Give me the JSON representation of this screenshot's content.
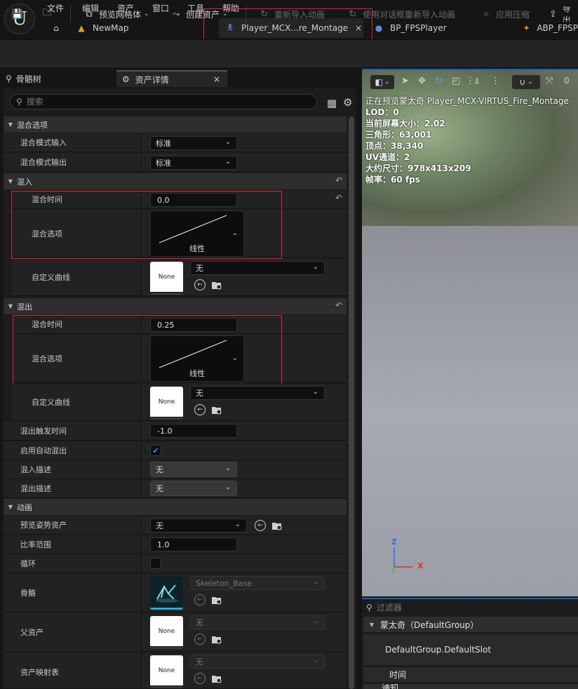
{
  "menu": [
    "文件",
    "编辑",
    "资产",
    "窗口",
    "工具",
    "帮助"
  ],
  "tabs": [
    {
      "label": "NewMap"
    },
    {
      "label": "Player_MCX...re_Montage"
    },
    {
      "label": "BP_FPSPlayer"
    },
    {
      "label": "ABP_FPSP"
    }
  ],
  "toolbar": {
    "preview_mesh": "预览网格体",
    "create_asset": "创建资产",
    "reimport": "重新导入动画",
    "reimport_dialog": "使用对话框重新导入动画",
    "apply_compression": "应用压缩",
    "export": "导出"
  },
  "panels": {
    "skeleton_tree": "骨骼树",
    "asset_details": "资产详情"
  },
  "search": {
    "placeholder": "搜索"
  },
  "blend_options": {
    "category": "混合选项",
    "blend_mode_in_label": "混合模式输入",
    "blend_mode_in_value": "标准",
    "blend_mode_out_label": "混合模式输出",
    "blend_mode_out_value": "标准"
  },
  "blend_in": {
    "category": "混入",
    "time_label": "混合时间",
    "time_value": "0.0",
    "option_label": "混合选项",
    "option_value": "线性",
    "custom_curve_label": "自定义曲线",
    "custom_curve_value": "无",
    "curve_thumb": "None"
  },
  "blend_out": {
    "category": "混出",
    "time_label": "混合时间",
    "time_value": "0.25",
    "option_label": "混合选项",
    "option_value": "线性",
    "custom_curve_label": "自定义曲线",
    "custom_curve_value": "无",
    "curve_thumb": "None"
  },
  "misc": {
    "trigger_time_label": "混出触发时间",
    "trigger_time_value": "-1.0",
    "auto_blend_out_label": "启用自动混出",
    "blend_in_desc_label": "混入描述",
    "blend_in_desc_value": "无",
    "blend_out_desc_label": "混出描述",
    "blend_out_desc_value": "无"
  },
  "animation": {
    "category": "动画",
    "preview_pose_label": "预览姿势资产",
    "preview_pose_value": "无",
    "rate_scale_label": "比率范围",
    "rate_scale_value": "1.0",
    "loop_label": "循环",
    "skeleton_label": "骨骼",
    "skeleton_value": "Skeleton_Base",
    "parent_label": "父资产",
    "parent_value": "无",
    "parent_thumb": "None",
    "asset_map_label": "资产映射表",
    "asset_map_value": "无",
    "asset_map_thumb": "None"
  },
  "viewport": {
    "lod_label": "LOD：",
    "lod_value": "0",
    "previewing": "正在预览蒙太奇 Player_MCX-VIRTUS_Fire_Montage",
    "screen_size": "当前屏幕大小：2.02",
    "triangles": "三角形：63,001",
    "vertices": "顶点：38,340",
    "uv_channels": "UV通道：2",
    "approx_size": "大约尺寸：978x413x209",
    "fps": "帧率：60 fps",
    "speed": "0",
    "axis_z": "Z",
    "axis_x": "X"
  },
  "slots": {
    "filter_placeholder": "过滤器",
    "group": "蒙太奇（DefaultGroup）",
    "slot": "DefaultGroup.DefaultSlot",
    "time": "时间",
    "notifies": "通知"
  },
  "colors": {
    "accent_red": "#e0242b",
    "accent_blue": "#1f5fbf",
    "check_blue": "#3d8ef0"
  }
}
